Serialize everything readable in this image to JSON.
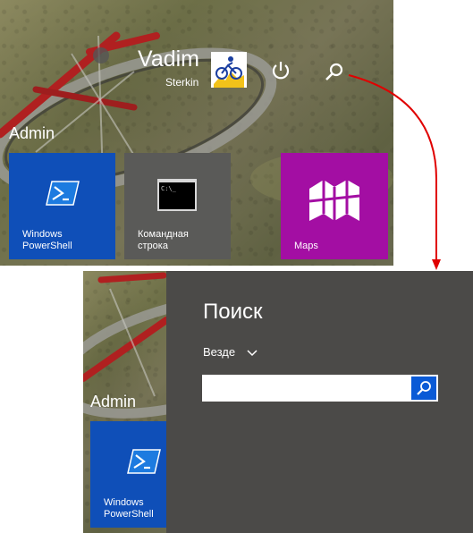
{
  "start_screen": {
    "user": {
      "first_name": "Vadim",
      "last_name": "Sterkin"
    },
    "group_label": "Admin",
    "tiles": [
      {
        "label_line1": "Windows",
        "label_line2": "PowerShell",
        "icon": "powershell-icon"
      },
      {
        "label_line1": "Командная",
        "label_line2": "строка",
        "icon": "command-prompt-icon"
      },
      {
        "label_line1": "Maps",
        "label_line2": "",
        "icon": "maps-icon"
      }
    ],
    "icons": {
      "power": "power-icon",
      "search": "search-icon"
    }
  },
  "search_charm": {
    "title": "Поиск",
    "scope_label": "Везде",
    "input_value": "",
    "input_placeholder": "",
    "search_button_icon": "search-icon",
    "group_label": "Admin",
    "tile": {
      "label_line1": "Windows",
      "label_line2": "PowerShell"
    }
  },
  "colors": {
    "tile_blue": "#0f4fb8",
    "tile_gray": "#5a5a58",
    "tile_purple": "#a30ea3",
    "search_pane_bg": "#4b4a48",
    "search_button": "#0a5ad6",
    "annotation_arrow": "#e00000"
  }
}
